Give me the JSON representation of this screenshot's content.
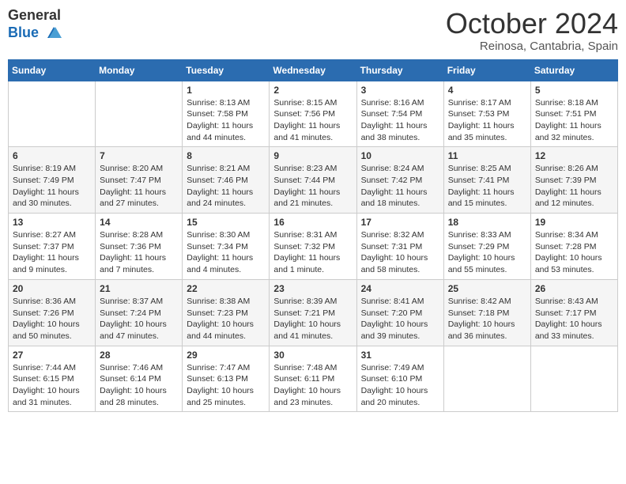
{
  "logo": {
    "general": "General",
    "blue": "Blue"
  },
  "title": "October 2024",
  "location": "Reinosa, Cantabria, Spain",
  "weekdays": [
    "Sunday",
    "Monday",
    "Tuesday",
    "Wednesday",
    "Thursday",
    "Friday",
    "Saturday"
  ],
  "weeks": [
    [
      {
        "day": "",
        "info": ""
      },
      {
        "day": "",
        "info": ""
      },
      {
        "day": "1",
        "info": "Sunrise: 8:13 AM\nSunset: 7:58 PM\nDaylight: 11 hours and 44 minutes."
      },
      {
        "day": "2",
        "info": "Sunrise: 8:15 AM\nSunset: 7:56 PM\nDaylight: 11 hours and 41 minutes."
      },
      {
        "day": "3",
        "info": "Sunrise: 8:16 AM\nSunset: 7:54 PM\nDaylight: 11 hours and 38 minutes."
      },
      {
        "day": "4",
        "info": "Sunrise: 8:17 AM\nSunset: 7:53 PM\nDaylight: 11 hours and 35 minutes."
      },
      {
        "day": "5",
        "info": "Sunrise: 8:18 AM\nSunset: 7:51 PM\nDaylight: 11 hours and 32 minutes."
      }
    ],
    [
      {
        "day": "6",
        "info": "Sunrise: 8:19 AM\nSunset: 7:49 PM\nDaylight: 11 hours and 30 minutes."
      },
      {
        "day": "7",
        "info": "Sunrise: 8:20 AM\nSunset: 7:47 PM\nDaylight: 11 hours and 27 minutes."
      },
      {
        "day": "8",
        "info": "Sunrise: 8:21 AM\nSunset: 7:46 PM\nDaylight: 11 hours and 24 minutes."
      },
      {
        "day": "9",
        "info": "Sunrise: 8:23 AM\nSunset: 7:44 PM\nDaylight: 11 hours and 21 minutes."
      },
      {
        "day": "10",
        "info": "Sunrise: 8:24 AM\nSunset: 7:42 PM\nDaylight: 11 hours and 18 minutes."
      },
      {
        "day": "11",
        "info": "Sunrise: 8:25 AM\nSunset: 7:41 PM\nDaylight: 11 hours and 15 minutes."
      },
      {
        "day": "12",
        "info": "Sunrise: 8:26 AM\nSunset: 7:39 PM\nDaylight: 11 hours and 12 minutes."
      }
    ],
    [
      {
        "day": "13",
        "info": "Sunrise: 8:27 AM\nSunset: 7:37 PM\nDaylight: 11 hours and 9 minutes."
      },
      {
        "day": "14",
        "info": "Sunrise: 8:28 AM\nSunset: 7:36 PM\nDaylight: 11 hours and 7 minutes."
      },
      {
        "day": "15",
        "info": "Sunrise: 8:30 AM\nSunset: 7:34 PM\nDaylight: 11 hours and 4 minutes."
      },
      {
        "day": "16",
        "info": "Sunrise: 8:31 AM\nSunset: 7:32 PM\nDaylight: 11 hours and 1 minute."
      },
      {
        "day": "17",
        "info": "Sunrise: 8:32 AM\nSunset: 7:31 PM\nDaylight: 10 hours and 58 minutes."
      },
      {
        "day": "18",
        "info": "Sunrise: 8:33 AM\nSunset: 7:29 PM\nDaylight: 10 hours and 55 minutes."
      },
      {
        "day": "19",
        "info": "Sunrise: 8:34 AM\nSunset: 7:28 PM\nDaylight: 10 hours and 53 minutes."
      }
    ],
    [
      {
        "day": "20",
        "info": "Sunrise: 8:36 AM\nSunset: 7:26 PM\nDaylight: 10 hours and 50 minutes."
      },
      {
        "day": "21",
        "info": "Sunrise: 8:37 AM\nSunset: 7:24 PM\nDaylight: 10 hours and 47 minutes."
      },
      {
        "day": "22",
        "info": "Sunrise: 8:38 AM\nSunset: 7:23 PM\nDaylight: 10 hours and 44 minutes."
      },
      {
        "day": "23",
        "info": "Sunrise: 8:39 AM\nSunset: 7:21 PM\nDaylight: 10 hours and 41 minutes."
      },
      {
        "day": "24",
        "info": "Sunrise: 8:41 AM\nSunset: 7:20 PM\nDaylight: 10 hours and 39 minutes."
      },
      {
        "day": "25",
        "info": "Sunrise: 8:42 AM\nSunset: 7:18 PM\nDaylight: 10 hours and 36 minutes."
      },
      {
        "day": "26",
        "info": "Sunrise: 8:43 AM\nSunset: 7:17 PM\nDaylight: 10 hours and 33 minutes."
      }
    ],
    [
      {
        "day": "27",
        "info": "Sunrise: 7:44 AM\nSunset: 6:15 PM\nDaylight: 10 hours and 31 minutes."
      },
      {
        "day": "28",
        "info": "Sunrise: 7:46 AM\nSunset: 6:14 PM\nDaylight: 10 hours and 28 minutes."
      },
      {
        "day": "29",
        "info": "Sunrise: 7:47 AM\nSunset: 6:13 PM\nDaylight: 10 hours and 25 minutes."
      },
      {
        "day": "30",
        "info": "Sunrise: 7:48 AM\nSunset: 6:11 PM\nDaylight: 10 hours and 23 minutes."
      },
      {
        "day": "31",
        "info": "Sunrise: 7:49 AM\nSunset: 6:10 PM\nDaylight: 10 hours and 20 minutes."
      },
      {
        "day": "",
        "info": ""
      },
      {
        "day": "",
        "info": ""
      }
    ]
  ]
}
